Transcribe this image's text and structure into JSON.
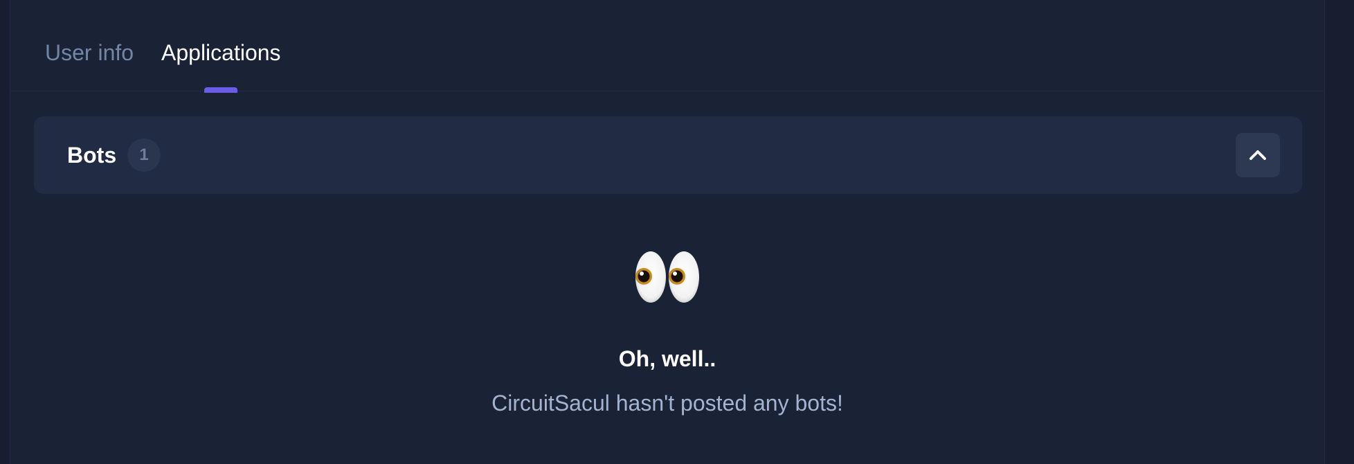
{
  "tabs": [
    {
      "label": "User info",
      "active": false
    },
    {
      "label": "Applications",
      "active": true
    }
  ],
  "colors": {
    "accent": "#6d5ce8",
    "panel_bg": "#1a2236",
    "card_bg": "#212b43"
  },
  "bots_section": {
    "title": "Bots",
    "count": "1",
    "toggle_icon": "chevron-up-icon",
    "expanded": true
  },
  "empty_state": {
    "icon": "eyes-icon",
    "title": "Oh, well..",
    "message": "CircuitSacul hasn't posted any bots!"
  }
}
